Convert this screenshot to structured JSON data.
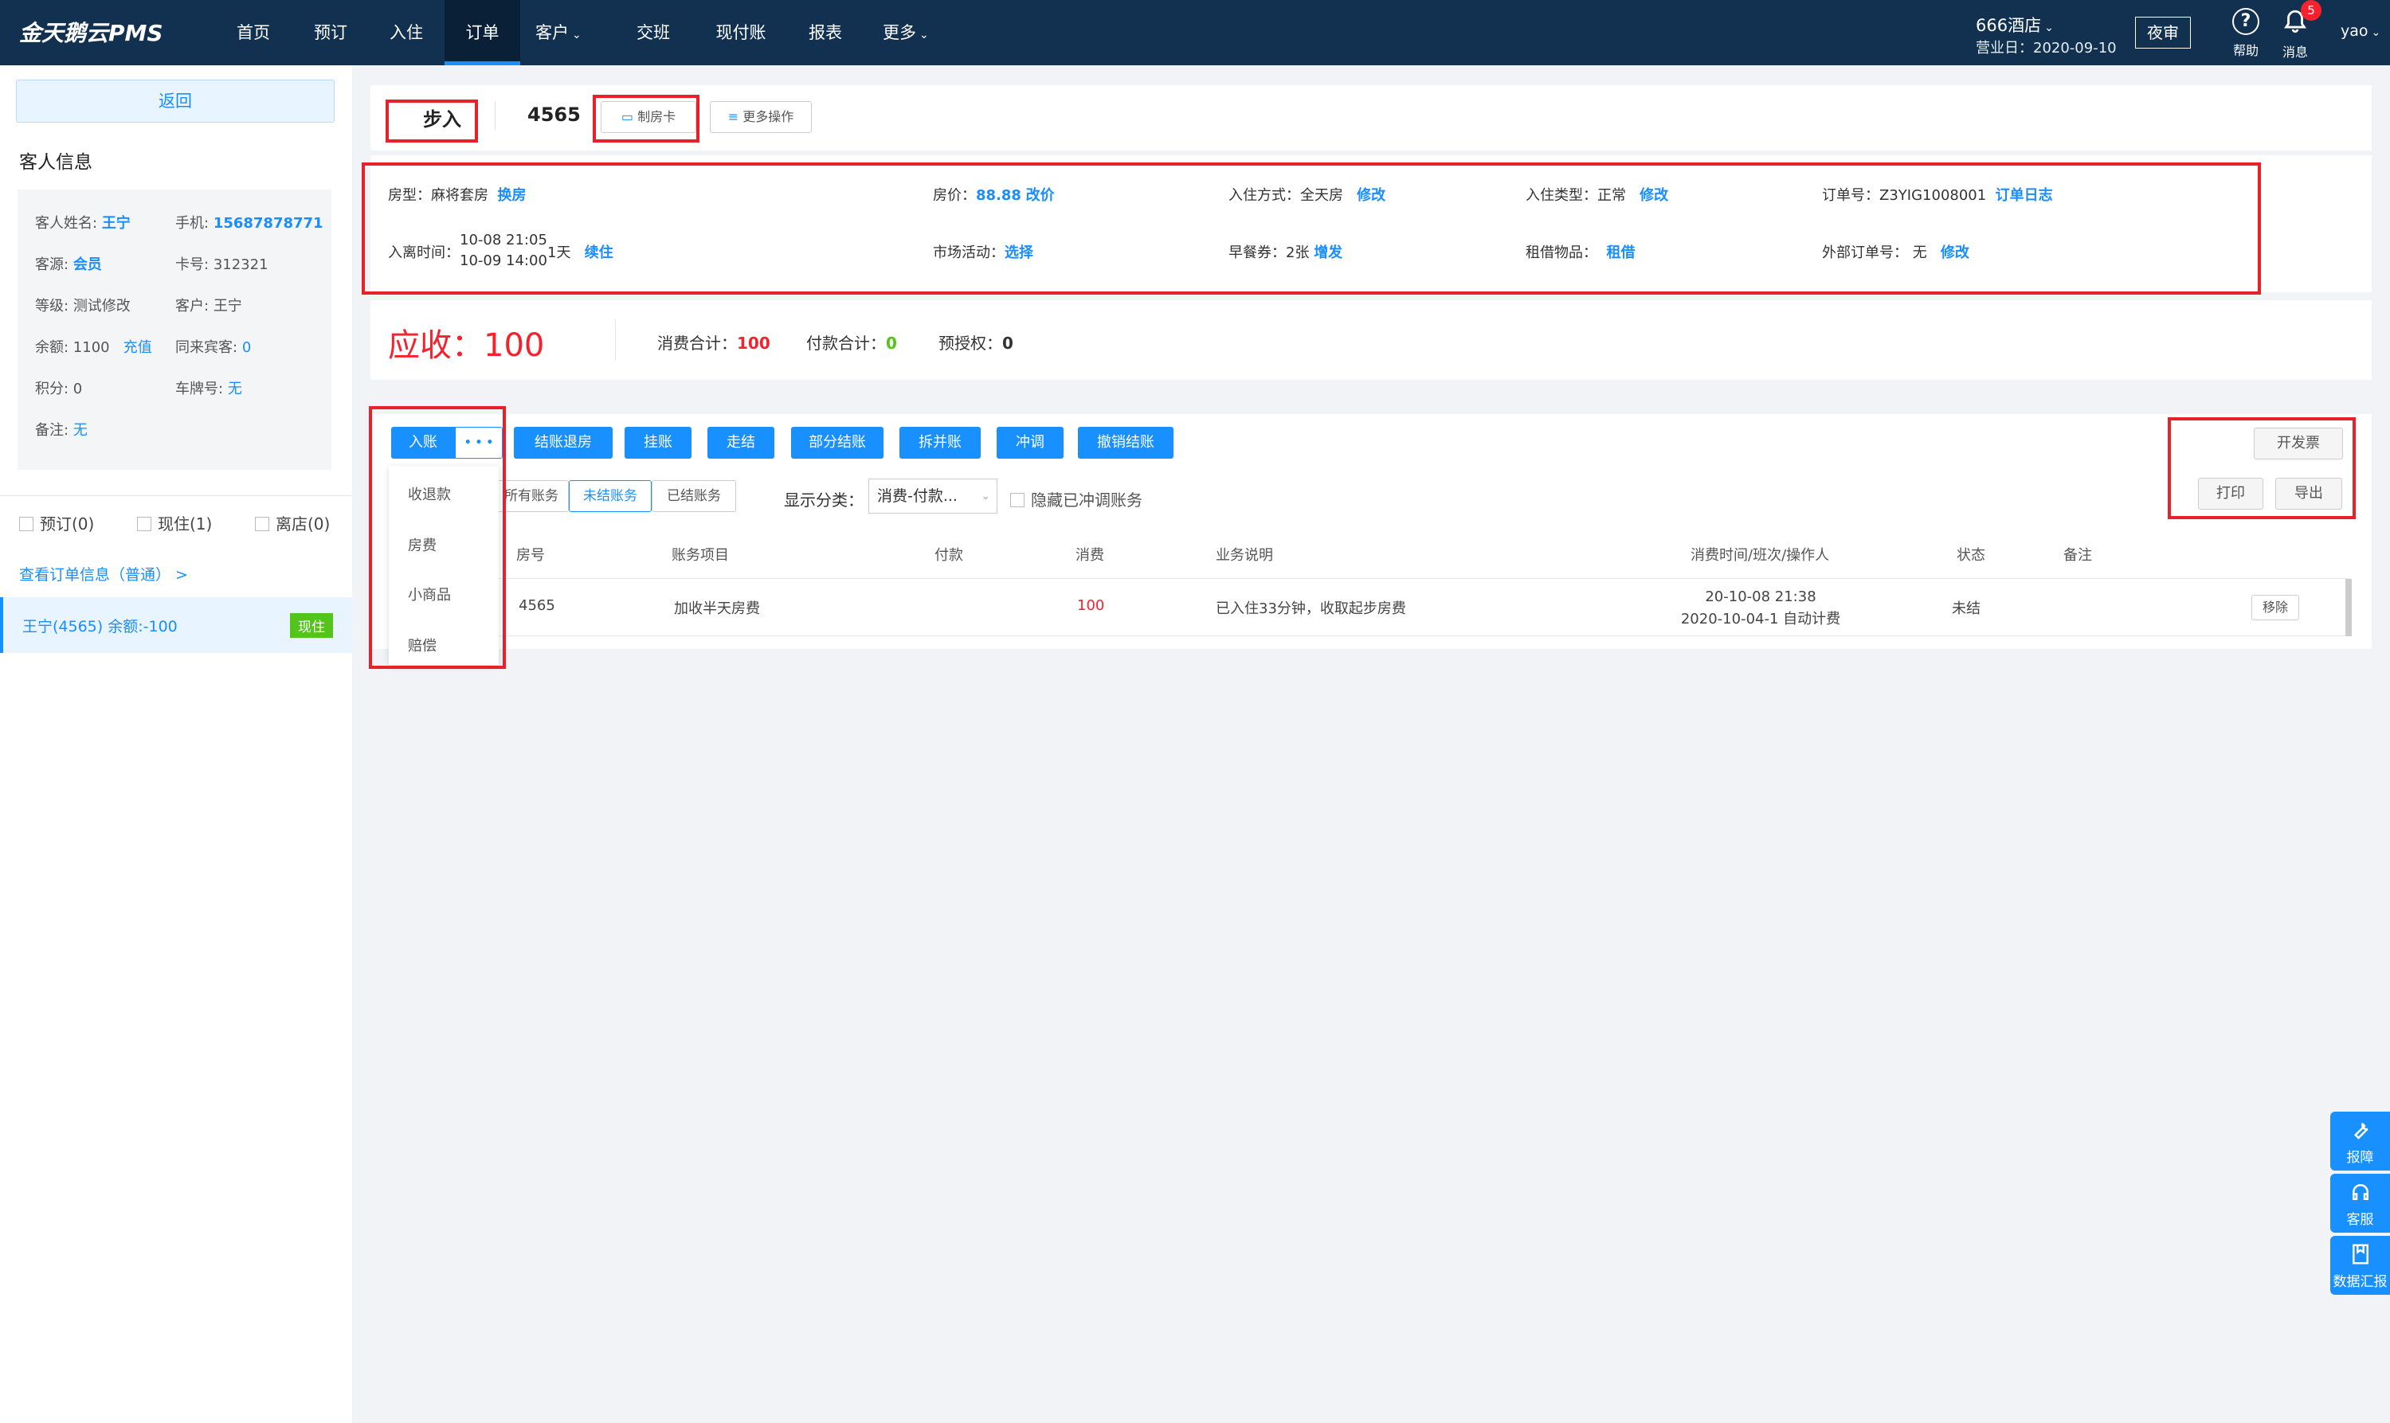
{
  "nav": {
    "logo": "金天鹅云PMS",
    "items": [
      "首页",
      "预订",
      "入住",
      "订单",
      "客户",
      "交班",
      "现付账",
      "报表",
      "更多"
    ],
    "active_index": 3,
    "hotel": "666酒店",
    "business_date": "营业日：2020-09-10",
    "night_audit": "夜审",
    "help": "帮助",
    "messages": "消息",
    "message_count": "5",
    "user": "yao",
    "caret": "⌄"
  },
  "left": {
    "back": "返回",
    "guest_info_title": "客人信息",
    "fields": {
      "name_label": "客人姓名:",
      "name": "王宁",
      "phone_label": "手机:",
      "phone": "15687878771",
      "source_label": "客源:",
      "source": "会员",
      "card_label": "卡号:",
      "card": "312321",
      "level_label": "等级:",
      "level": "测试修改",
      "customer_label": "客户:",
      "customer": "王宁",
      "balance_label": "余额: 1100",
      "recharge": "充值",
      "companions_label": "同来宾客:",
      "companions": "0",
      "points_label": "积分: 0",
      "plate_label": "车牌号:",
      "plate": "无",
      "remark_label": "备注:",
      "remark": "无"
    },
    "filters": [
      "预订(0)",
      "现住(1)",
      "离店(0)"
    ],
    "view_order": "查看订单信息（普通）  >",
    "guest_row": "王宁(4565)  余额:-100",
    "guest_row_tag": "现住"
  },
  "header": {
    "status": "步入",
    "room": "4565",
    "make_card": "制房卡",
    "more_ops": "更多操作"
  },
  "info": {
    "room_type_label": "房型：",
    "room_type": "麻将套房",
    "change_room": "换房",
    "price_label": "房价：",
    "price": "88.88",
    "change_price": "改价",
    "checkin_mode_label": "入住方式：",
    "checkin_mode": "全天房",
    "edit1": "修改",
    "checkin_type_label": "入住类型：",
    "checkin_type": "正常",
    "edit2": "修改",
    "order_no_label": "订单号：",
    "order_no": "Z3YIG1008001",
    "order_log": "订单日志",
    "stay_label": "入离时间：",
    "stay_in": "10-08 21:05",
    "stay_out": "10-09 14:00",
    "nights": "1天",
    "extend": "续住",
    "market_label": "市场活动：",
    "market": "选择",
    "breakfast_label": "早餐券：",
    "breakfast": "2张",
    "breakfast_add": "增发",
    "rental_label": "租借物品：",
    "rental": "租借",
    "ext_order_label": "外部订单号：",
    "ext_order": "无",
    "edit3": "修改"
  },
  "summary": {
    "receivable_label": "应收：",
    "receivable": "100",
    "consume_label": "消费合计：",
    "consume": "100",
    "pay_label": "付款合计：",
    "pay": "0",
    "preauth_label": "预授权：",
    "preauth": "0"
  },
  "bill": {
    "post": "入账",
    "more": "• • •",
    "actions": [
      "结账退房",
      "挂账",
      "走结",
      "部分结账",
      "拆并账",
      "冲调",
      "撤销结账"
    ],
    "tabs": [
      "所有账务",
      "未结账务",
      "已结账务"
    ],
    "active_tab": 1,
    "display_label": "显示分类：",
    "display_value": "消费-付款...",
    "hide_reversed": "隐藏已冲调账务",
    "invoice": "开发票",
    "print": "打印",
    "export": "导出",
    "dropdown": [
      "收退款",
      "房费",
      "小商品",
      "赔偿"
    ],
    "columns": [
      "房号",
      "账务项目",
      "付款",
      "消费",
      "业务说明",
      "消费时间/班次/操作人",
      "状态",
      "备注"
    ],
    "rows": [
      {
        "room": "4565",
        "item": "加收半天房费",
        "pay": "",
        "consume": "100",
        "desc": "已入住33分钟，收取起步房费",
        "time1": "20-10-08 21:38",
        "time2": "2020-10-04-1 自动计费",
        "status": "未结",
        "remark": "",
        "action": "移除"
      }
    ]
  },
  "float": [
    {
      "label": "报障",
      "icon": "wrench-icon"
    },
    {
      "label": "客服",
      "icon": "headset-icon"
    },
    {
      "label": "数据汇报",
      "icon": "report-icon"
    }
  ]
}
